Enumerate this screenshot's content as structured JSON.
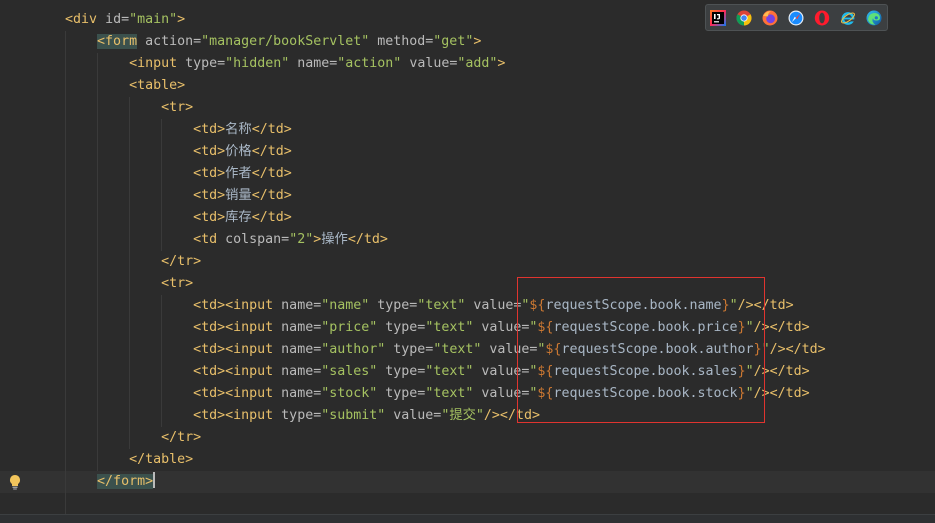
{
  "editor": {
    "colors": {
      "background": "#2b2b2b",
      "tag": "#e8bf6a",
      "attr": "#bababa",
      "string": "#a5c261",
      "text": "#a9b7c6",
      "el": "#cc7832",
      "match_bg": "#3b514d",
      "current_line": "#323232",
      "annotation_box": "#e0342f"
    },
    "lines": [
      {
        "indent_spaces": 4,
        "tokens": [
          [
            "tag",
            "<div"
          ],
          [
            "attr",
            " id="
          ],
          [
            "string",
            "\"main\""
          ],
          [
            "tag",
            ">"
          ]
        ]
      },
      {
        "indent_spaces": 8,
        "tokens": [
          [
            "tag-match",
            "<form"
          ],
          [
            "attr",
            " action="
          ],
          [
            "string",
            "\"manager/bookServlet\""
          ],
          [
            "attr",
            " method="
          ],
          [
            "string",
            "\"get\""
          ],
          [
            "tag",
            ">"
          ]
        ]
      },
      {
        "indent_spaces": 12,
        "tokens": [
          [
            "tag",
            "<input"
          ],
          [
            "attr",
            " type="
          ],
          [
            "string",
            "\"hidden\""
          ],
          [
            "attr",
            " name="
          ],
          [
            "string",
            "\"action\""
          ],
          [
            "attr",
            " value="
          ],
          [
            "string",
            "\"add\""
          ],
          [
            "tag",
            ">"
          ]
        ]
      },
      {
        "indent_spaces": 12,
        "tokens": [
          [
            "tag",
            "<table>"
          ]
        ]
      },
      {
        "indent_spaces": 16,
        "tokens": [
          [
            "tag",
            "<tr>"
          ]
        ]
      },
      {
        "indent_spaces": 20,
        "tokens": [
          [
            "tag",
            "<td>"
          ],
          [
            "text",
            "名称"
          ],
          [
            "tag",
            "</td>"
          ]
        ]
      },
      {
        "indent_spaces": 20,
        "tokens": [
          [
            "tag",
            "<td>"
          ],
          [
            "text",
            "价格"
          ],
          [
            "tag",
            "</td>"
          ]
        ]
      },
      {
        "indent_spaces": 20,
        "tokens": [
          [
            "tag",
            "<td>"
          ],
          [
            "text",
            "作者"
          ],
          [
            "tag",
            "</td>"
          ]
        ]
      },
      {
        "indent_spaces": 20,
        "tokens": [
          [
            "tag",
            "<td>"
          ],
          [
            "text",
            "销量"
          ],
          [
            "tag",
            "</td>"
          ]
        ]
      },
      {
        "indent_spaces": 20,
        "tokens": [
          [
            "tag",
            "<td>"
          ],
          [
            "text",
            "库存"
          ],
          [
            "tag",
            "</td>"
          ]
        ]
      },
      {
        "indent_spaces": 20,
        "tokens": [
          [
            "tag",
            "<td"
          ],
          [
            "attr",
            " colspan="
          ],
          [
            "string",
            "\"2\""
          ],
          [
            "tag",
            ">"
          ],
          [
            "text",
            "操作"
          ],
          [
            "tag",
            "</td>"
          ]
        ]
      },
      {
        "indent_spaces": 16,
        "tokens": [
          [
            "tag",
            "</tr>"
          ]
        ]
      },
      {
        "indent_spaces": 16,
        "tokens": [
          [
            "tag",
            "<tr>"
          ]
        ]
      },
      {
        "indent_spaces": 20,
        "tokens": [
          [
            "tag",
            "<td><input"
          ],
          [
            "attr",
            " name="
          ],
          [
            "string",
            "\"name\""
          ],
          [
            "attr",
            " type="
          ],
          [
            "string",
            "\"text\""
          ],
          [
            "attr",
            " value="
          ],
          [
            "string",
            "\""
          ],
          [
            "el",
            "${"
          ],
          [
            "el-expr",
            "requestScope.book.name"
          ],
          [
            "el",
            "}"
          ],
          [
            "string",
            "\""
          ],
          [
            "tag",
            "/></td>"
          ]
        ]
      },
      {
        "indent_spaces": 20,
        "tokens": [
          [
            "tag",
            "<td><input"
          ],
          [
            "attr",
            " name="
          ],
          [
            "string",
            "\"price\""
          ],
          [
            "attr",
            " type="
          ],
          [
            "string",
            "\"text\""
          ],
          [
            "attr",
            " value="
          ],
          [
            "string",
            "\""
          ],
          [
            "el",
            "${"
          ],
          [
            "el-expr",
            "requestScope.book.price"
          ],
          [
            "el",
            "}"
          ],
          [
            "string",
            "\""
          ],
          [
            "tag",
            "/></td>"
          ]
        ]
      },
      {
        "indent_spaces": 20,
        "tokens": [
          [
            "tag",
            "<td><input"
          ],
          [
            "attr",
            " name="
          ],
          [
            "string",
            "\"author\""
          ],
          [
            "attr",
            " type="
          ],
          [
            "string",
            "\"text\""
          ],
          [
            "attr",
            " value="
          ],
          [
            "string",
            "\""
          ],
          [
            "el",
            "${"
          ],
          [
            "el-expr",
            "requestScope.book.author"
          ],
          [
            "el",
            "}"
          ],
          [
            "string",
            "\""
          ],
          [
            "tag",
            "/></td>"
          ]
        ]
      },
      {
        "indent_spaces": 20,
        "tokens": [
          [
            "tag",
            "<td><input"
          ],
          [
            "attr",
            " name="
          ],
          [
            "string",
            "\"sales\""
          ],
          [
            "attr",
            " type="
          ],
          [
            "string",
            "\"text\""
          ],
          [
            "attr",
            " value="
          ],
          [
            "string",
            "\""
          ],
          [
            "el",
            "${"
          ],
          [
            "el-expr",
            "requestScope.book.sales"
          ],
          [
            "el",
            "}"
          ],
          [
            "string",
            "\""
          ],
          [
            "tag",
            "/></td>"
          ]
        ]
      },
      {
        "indent_spaces": 20,
        "tokens": [
          [
            "tag",
            "<td><input"
          ],
          [
            "attr",
            " name="
          ],
          [
            "string",
            "\"stock\""
          ],
          [
            "attr",
            " type="
          ],
          [
            "string",
            "\"text\""
          ],
          [
            "attr",
            " value="
          ],
          [
            "string",
            "\""
          ],
          [
            "el",
            "${"
          ],
          [
            "el-expr",
            "requestScope.book.stock"
          ],
          [
            "el",
            "}"
          ],
          [
            "string",
            "\""
          ],
          [
            "tag",
            "/></td>"
          ]
        ]
      },
      {
        "indent_spaces": 20,
        "tokens": [
          [
            "tag",
            "<td><input"
          ],
          [
            "attr",
            " type="
          ],
          [
            "string",
            "\"submit\""
          ],
          [
            "attr",
            " value="
          ],
          [
            "string",
            "\"提交\""
          ],
          [
            "tag",
            "/></td>"
          ]
        ]
      },
      {
        "indent_spaces": 16,
        "tokens": [
          [
            "tag",
            "</tr>"
          ]
        ]
      },
      {
        "indent_spaces": 12,
        "tokens": [
          [
            "tag",
            "</table>"
          ]
        ]
      },
      {
        "indent_spaces": 8,
        "current": true,
        "tokens": [
          [
            "tag-match",
            "</form>"
          ]
        ]
      }
    ]
  },
  "toolbar": {
    "icons": [
      "intellij-idea-icon",
      "chrome-icon",
      "firefox-icon",
      "safari-icon",
      "opera-icon",
      "internet-explorer-icon",
      "edge-icon"
    ]
  },
  "gutter": {
    "intention_icon": "lightbulb-icon"
  }
}
